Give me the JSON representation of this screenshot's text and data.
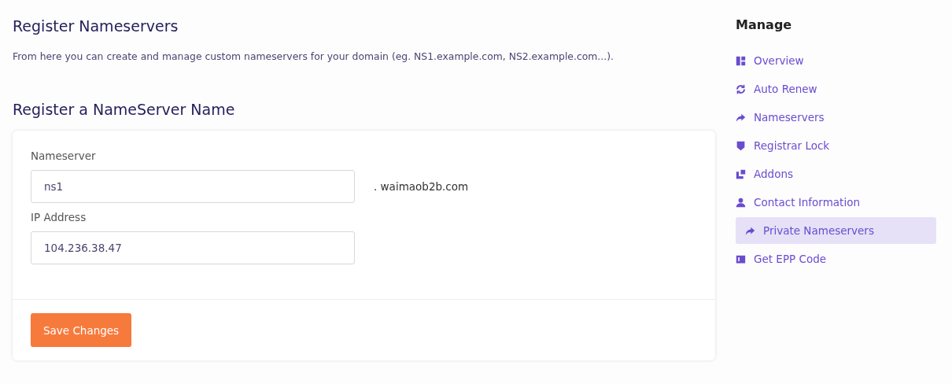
{
  "page_title": "Register Nameservers",
  "description": "From here you can create and manage custom nameservers for your domain (eg. NS1.example.com, NS2.example.com...).",
  "form": {
    "title": "Register a NameServer Name",
    "fields": [
      {
        "label": "Nameserver",
        "value": "ns1",
        "suffix": ". waimaob2b.com"
      },
      {
        "label": "IP Address",
        "value": "104.236.38.47"
      }
    ],
    "submit": "Save Changes"
  },
  "sidebar": {
    "title": "Manage",
    "items": [
      {
        "label": "Overview",
        "selected": false
      },
      {
        "label": "Auto Renew",
        "selected": false
      },
      {
        "label": "Nameservers",
        "selected": false
      },
      {
        "label": "Registrar Lock",
        "selected": false
      },
      {
        "label": "Addons",
        "selected": false
      },
      {
        "label": "Contact Information",
        "selected": false
      },
      {
        "label": "Private Nameservers",
        "selected": true
      },
      {
        "label": "Get EPP Code",
        "selected": false
      }
    ]
  }
}
